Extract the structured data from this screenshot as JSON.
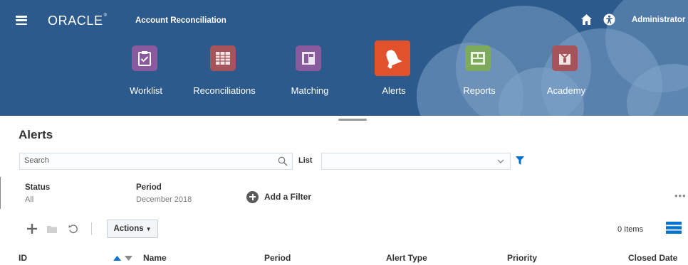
{
  "header": {
    "brand": "ORACLE",
    "app_title": "Account Reconciliation",
    "user_menu": "Administrator"
  },
  "nav": [
    {
      "label": "Worklist",
      "icon": "clipboard-check-icon",
      "color": "#8a5a9e"
    },
    {
      "label": "Reconciliations",
      "icon": "ledger-icon",
      "color": "#a5555a"
    },
    {
      "label": "Matching",
      "icon": "matching-icon",
      "color": "#8a5a9e"
    },
    {
      "label": "Alerts",
      "icon": "bell-icon",
      "color": "#e0512c",
      "active": true
    },
    {
      "label": "Reports",
      "icon": "report-icon",
      "color": "#7dab5b"
    },
    {
      "label": "Academy",
      "icon": "academy-icon",
      "color": "#a5555a"
    }
  ],
  "page": {
    "title": "Alerts"
  },
  "search": {
    "placeholder": "Search",
    "list_label": "List",
    "list_value": ""
  },
  "facets": [
    {
      "label": "Status",
      "value": "All"
    },
    {
      "label": "Period",
      "value": "December 2018"
    }
  ],
  "add_filter_label": "Add a Filter",
  "more_label": "•••",
  "toolbar": {
    "actions_label": "Actions",
    "items_count": "0 Items"
  },
  "table": {
    "columns": [
      "ID",
      "Name",
      "Period",
      "Alert Type",
      "Priority",
      "Closed Date"
    ]
  },
  "colors": {
    "banner": "#2c5a8c",
    "accent_blue": "#0572ce",
    "active_tile": "#e0512c"
  }
}
